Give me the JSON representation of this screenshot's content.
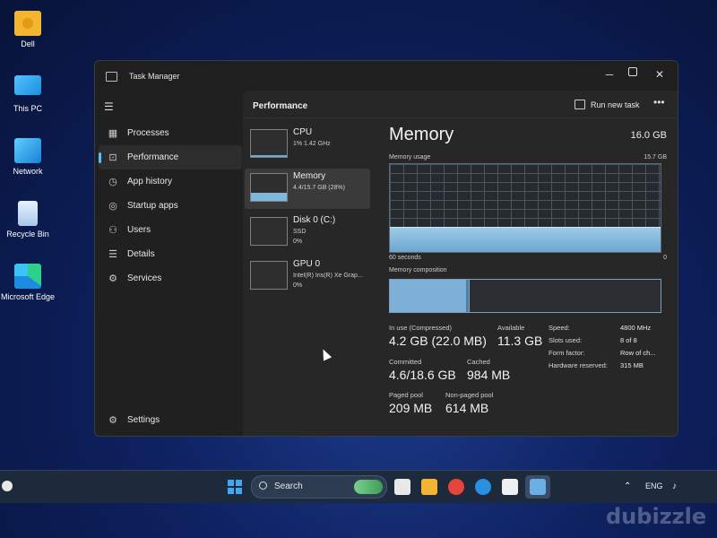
{
  "desktop": {
    "icons": [
      {
        "label": "Dell",
        "icon": "folder-icon"
      },
      {
        "label": "This PC",
        "icon": "monitor-icon"
      },
      {
        "label": "Network",
        "icon": "network-icon"
      },
      {
        "label": "Recycle Bin",
        "icon": "recycle-bin-icon"
      },
      {
        "label": "Microsoft Edge",
        "icon": "edge-icon"
      }
    ]
  },
  "window": {
    "title": "Task Manager",
    "controls": {
      "minimize": "─",
      "close": "✕"
    }
  },
  "sidebar": {
    "menu_icon": "☰",
    "items": [
      {
        "label": "Processes",
        "icon": "▦"
      },
      {
        "label": "Performance",
        "icon": "⊡",
        "active": true
      },
      {
        "label": "App history",
        "icon": "◷"
      },
      {
        "label": "Startup apps",
        "icon": "◎"
      },
      {
        "label": "Users",
        "icon": "⚇"
      },
      {
        "label": "Details",
        "icon": "☰"
      },
      {
        "label": "Services",
        "icon": "⚙"
      }
    ],
    "settings": {
      "label": "Settings",
      "icon": "⚙"
    }
  },
  "header": {
    "title": "Performance",
    "run_task_label": "Run new task",
    "more_label": "•••"
  },
  "resources": [
    {
      "name": "CPU",
      "sub": "1%  1.42 GHz",
      "sub2": ""
    },
    {
      "name": "Memory",
      "sub": "4.4/15.7 GB (28%)",
      "sub2": ""
    },
    {
      "name": "Disk 0 (C:)",
      "sub": "SSD",
      "sub2": "0%"
    },
    {
      "name": "GPU 0",
      "sub": "Intel(R) Iris(R) Xe Grap...",
      "sub2": "0%"
    }
  ],
  "memory": {
    "title": "Memory",
    "total": "16.0 GB",
    "usage_label": "Memory usage",
    "usage_max": "15.7 GB",
    "usage_fraction": 0.28,
    "axis_left": "60 seconds",
    "axis_right": "0",
    "composition_label": "Memory composition",
    "composition": {
      "in_use": 0.28,
      "modified": 0.01,
      "standby": 0.33
    },
    "stats": {
      "in_use_label": "In use (Compressed)",
      "in_use": "4.2 GB (22.0 MB)",
      "available_label": "Available",
      "available": "11.3 GB",
      "committed_label": "Committed",
      "committed": "4.6/18.6 GB",
      "cached_label": "Cached",
      "cached": "984 MB",
      "paged_label": "Paged pool",
      "paged": "209 MB",
      "nonpaged_label": "Non-paged pool",
      "nonpaged": "614 MB"
    },
    "specs": [
      {
        "key": "Speed:",
        "value": "4800 MHz"
      },
      {
        "key": "Slots used:",
        "value": "8 of 8"
      },
      {
        "key": "Form factor:",
        "value": "Row of ch..."
      },
      {
        "key": "Hardware reserved:",
        "value": "315 MB"
      }
    ]
  },
  "taskbar": {
    "search_label": "Search",
    "lang": "ENG",
    "tray_icons": [
      "⌃",
      "♪"
    ],
    "apps": [
      {
        "name": "widgets-icon",
        "color": "#e8e8e8"
      },
      {
        "name": "file-explorer-icon",
        "color": "#f2b632"
      },
      {
        "name": "chrome-icon",
        "color": "#e5463b"
      },
      {
        "name": "edge-icon",
        "color": "#2a8fe0"
      },
      {
        "name": "store-icon",
        "color": "#f0f0f0"
      },
      {
        "name": "task-manager-icon",
        "color": "#6ab0e6"
      }
    ]
  },
  "watermark": "dubizzle",
  "colors": {
    "accent": "#4cc2ff",
    "graph_fill": "#7db0d6"
  }
}
